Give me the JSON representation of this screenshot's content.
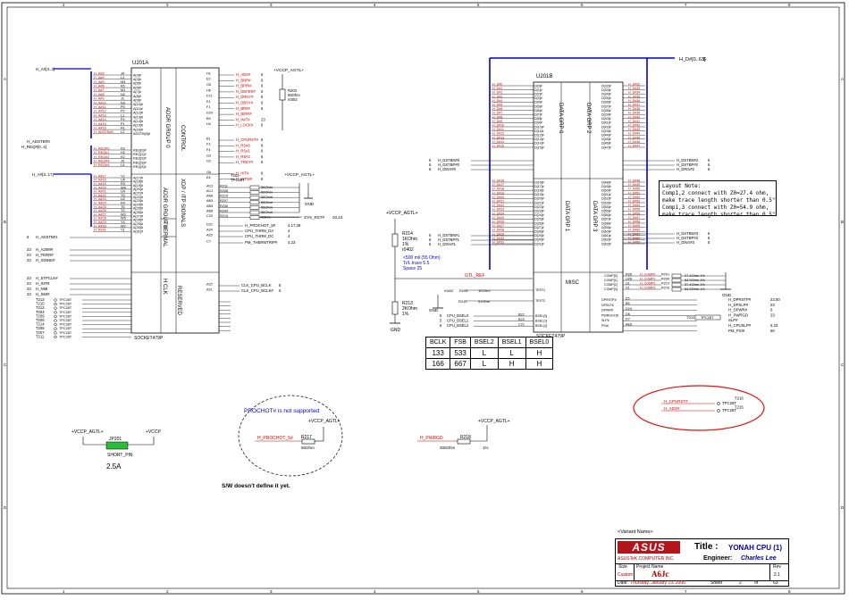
{
  "grid": {
    "cols": [
      "1",
      "2",
      "3",
      "4",
      "5",
      "6",
      "7",
      "8"
    ],
    "rows": [
      "A",
      "B",
      "C",
      "D"
    ]
  },
  "u_left": {
    "ref": "U201A",
    "part": "SOCKET479P",
    "section_labels": [
      "ADDR GROUP 0",
      "CONTROL",
      "ADDR GROUP 1",
      "XDP / ITP SIGNALS",
      "THERMAL",
      "H CLK",
      "RESERVED"
    ],
    "left_pins": [
      {
        "sig": "H_A#3",
        "pin": "J4",
        "num": "A[3]#"
      },
      {
        "sig": "H_A#4",
        "pin": "L4",
        "num": "A[4]#"
      },
      {
        "sig": "H_A#5",
        "pin": "M3",
        "num": "A[5]#"
      },
      {
        "sig": "H_A#6",
        "pin": "K5",
        "num": "A[6]#"
      },
      {
        "sig": "H_A#7",
        "pin": "M1",
        "num": "A[7]#"
      },
      {
        "sig": "H_A#8",
        "pin": "N2",
        "num": "A[8]#"
      },
      {
        "sig": "H_A#9",
        "pin": "J1",
        "num": "A[9]#"
      },
      {
        "sig": "H_A#10",
        "pin": "N3",
        "num": "A[10]#"
      },
      {
        "sig": "H_A#11",
        "pin": "P5",
        "num": "A[11]#"
      },
      {
        "sig": "H_A#12",
        "pin": "P2",
        "num": "A[12]#"
      },
      {
        "sig": "H_A#13",
        "pin": "L1",
        "num": "A[13]#"
      },
      {
        "sig": "H_A#14",
        "pin": "P4",
        "num": "A[14]#"
      },
      {
        "sig": "H_A#15",
        "pin": "P1",
        "num": "A[15]#"
      },
      {
        "sig": "H_A#16",
        "pin": "R1",
        "num": "A[16]#"
      },
      {
        "sig": "H_ADSTB#0",
        "pin": "L2",
        "num": "ADSTB[0]#"
      }
    ],
    "req_pins": [
      {
        "sig": "H_REQ#0",
        "pin": "K3"
      },
      {
        "sig": "H_REQ#1",
        "pin": "H2"
      },
      {
        "sig": "H_REQ#2",
        "pin": "K2"
      },
      {
        "sig": "H_REQ#3",
        "pin": "J3"
      },
      {
        "sig": "H_REQ#4",
        "pin": "L5"
      }
    ],
    "a17_pins": [
      {
        "sig": "H_A#17",
        "pin": "Y2"
      },
      {
        "sig": "H_A#18",
        "pin": "U5"
      },
      {
        "sig": "H_A#19",
        "pin": "R3"
      },
      {
        "sig": "H_A#20",
        "pin": "W6"
      },
      {
        "sig": "H_A#21",
        "pin": "U4"
      },
      {
        "sig": "H_A#22",
        "pin": "Y5"
      },
      {
        "sig": "H_A#23",
        "pin": "U2"
      },
      {
        "sig": "H_A#24",
        "pin": "R4"
      },
      {
        "sig": "H_A#25",
        "pin": "T5"
      },
      {
        "sig": "H_A#26",
        "pin": "T3"
      },
      {
        "sig": "H_A#27",
        "pin": "W3"
      },
      {
        "sig": "H_A#28",
        "pin": "W5"
      },
      {
        "sig": "H_A#29",
        "pin": "Y4"
      },
      {
        "sig": "H_A#30",
        "pin": "W2"
      },
      {
        "sig": "H_A#31",
        "pin": "Y1"
      }
    ],
    "ctrl_right": [
      {
        "pin": "H1",
        "sig": "H_ADS#",
        "num": "6"
      },
      {
        "pin": "E2",
        "sig": "H_BNR#",
        "num": "6"
      },
      {
        "pin": "G5",
        "sig": "H_BPRI#",
        "num": "6"
      },
      {
        "pin": "H5",
        "sig": "H_DEFER#",
        "num": "6"
      },
      {
        "pin": "F21",
        "sig": "H_DRDY#",
        "num": "6"
      },
      {
        "pin": "E1",
        "sig": "H_DBSY#",
        "num": "6"
      },
      {
        "pin": "F1",
        "sig": "H_BR0#",
        "num": "6"
      },
      {
        "pin": "D20",
        "sig": "H_IERR#",
        "num": ""
      },
      {
        "pin": "B3",
        "sig": "H_INIT#",
        "num": "23"
      },
      {
        "pin": "H4",
        "sig": "H_LOCK#",
        "num": "6"
      },
      {
        "pin": "B1",
        "sig": "H_CPURST#",
        "num": "6"
      },
      {
        "pin": "F3",
        "sig": "H_RS#0",
        "num": "6"
      },
      {
        "pin": "F4",
        "sig": "H_RS#1",
        "num": "6"
      },
      {
        "pin": "G3",
        "sig": "H_RS#2",
        "num": "6"
      },
      {
        "pin": "G2",
        "sig": "H_TRDY#",
        "num": "6"
      },
      {
        "pin": "G6",
        "sig": "H_HIT#",
        "num": "6"
      },
      {
        "pin": "E4",
        "sig": "H_HITM#",
        "num": "6"
      }
    ],
    "xdp_pins": [
      {
        "pin": "AC2",
        "ref": "R211",
        "val": "56Ohm"
      },
      {
        "pin": "AC1",
        "ref": "R208",
        "val": "56Ohm"
      },
      {
        "pin": "AA6",
        "ref": "R210",
        "val": "56Ohm"
      },
      {
        "pin": "AB3",
        "ref": "R207",
        "val": "56Ohm"
      },
      {
        "pin": "AB5",
        "ref": "R206",
        "val": "56Ohm"
      },
      {
        "pin": "AB6",
        "ref": "R209",
        "val": "56Ohm"
      },
      {
        "pin": "C20",
        "ref": "R219",
        "val": "0Ohm"
      }
    ],
    "thermal": [
      {
        "pin": "D21",
        "sig": "H_PROCHOT_5#",
        "num": "4,17,38"
      },
      {
        "pin": "A24",
        "sig": "CPU_THRM_DA",
        "num": "4"
      },
      {
        "pin": "A25",
        "sig": "CPU_THRM_DC",
        "num": "4"
      },
      {
        "pin": "C7",
        "sig": "PM_THERMTRIP#",
        "num": "4,23"
      }
    ],
    "bclk": [
      {
        "pin": "A22",
        "sig": "CLK_CPU_BCLK",
        "num": "5"
      },
      {
        "pin": "A21",
        "sig": "CLK_CPU_BCLK#",
        "num": "5"
      }
    ],
    "left_misc": [
      {
        "sig": "H_ADSTB#1",
        "num": "6"
      },
      {
        "sig": "H_A20M#",
        "num": "23"
      },
      {
        "sig": "H_FERR#",
        "num": "23"
      },
      {
        "sig": "H_IGNNE#",
        "num": "23"
      },
      {
        "sig": "H_STPCLK#",
        "num": "23"
      },
      {
        "sig": "H_INTR",
        "num": "23"
      },
      {
        "sig": "H_NMI",
        "num": "23"
      },
      {
        "sig": "H_SMI#",
        "num": "23"
      }
    ],
    "testpoints": [
      "T213",
      "T210",
      "T212",
      "T204",
      "T209",
      "T206",
      "T214",
      "T208",
      "T207",
      "T211"
    ],
    "tpc_label": "TPC28T",
    "r203": {
      "ref": "R203",
      "val": "56Ohm",
      "pkg": "r0402"
    },
    "t202": {
      "ref": "T202",
      "val": "TPC28T"
    },
    "sys_rst": "SYS_RST#",
    "sys_rst_num": "20,24",
    "gnd": "GND"
  },
  "u_right": {
    "ref": "U201B",
    "part": "SOCKET479P",
    "section_labels": [
      "DATA GRP 0",
      "DATA GRP 1",
      "DATA GRP 2",
      "DATA GRP 3",
      "MISC"
    ],
    "bus_label": "H_D#[0..63]",
    "bus_num": "6",
    "dstb": [
      {
        "sig": "H_DSTBN#0",
        "num": "6"
      },
      {
        "sig": "H_DSTBP#0",
        "num": "6"
      },
      {
        "sig": "H_DINV#0",
        "num": "6"
      },
      {
        "sig": "H_DSTBN#1",
        "num": "6"
      },
      {
        "sig": "H_DSTBP#1",
        "num": "6"
      },
      {
        "sig": "H_DINV#1",
        "num": "6"
      }
    ],
    "dstb_r": [
      {
        "sig": "H_DSTBN#2",
        "num": "6"
      },
      {
        "sig": "H_DSTBP#2",
        "num": "6"
      },
      {
        "sig": "H_DINV#2",
        "num": "6"
      },
      {
        "sig": "H_DSTBN#3",
        "num": "6"
      },
      {
        "sig": "H_DSTBP#3",
        "num": "6"
      },
      {
        "sig": "H_DINV#3",
        "num": "6"
      }
    ],
    "comp": [
      {
        "pin": "R26",
        "ref": "R201",
        "val": "27.4Ohm 1%"
      },
      {
        "pin": "U26",
        "ref": "R200",
        "val": "54.9Ohm 1%"
      },
      {
        "pin": "U1",
        "ref": "R213",
        "val": "27.4Ohm 1%"
      },
      {
        "pin": "V1",
        "ref": "R216",
        "val": "54.9Ohm 1%"
      }
    ],
    "comp_pins": [
      "COMP[0]",
      "COMP[1]",
      "COMP[2]",
      "COMP[3]"
    ],
    "misc_right": [
      {
        "pin": "E5",
        "sig": "H_DPRSTP#",
        "num": "23,50"
      },
      {
        "pin": "B5",
        "sig": "H_DPSLP#",
        "num": "23"
      },
      {
        "pin": "D24",
        "sig": "H_DPWR#",
        "num": "6"
      },
      {
        "pin": "D6",
        "sig": "H_PWRGD",
        "num": "23"
      },
      {
        "pin": "D7",
        "sig": "SLP#",
        "num": ""
      },
      {
        "pin": "AE6",
        "sig": "H_CPUSLP#",
        "num": "6,23"
      },
      {
        "pin": "",
        "sig": "PM_PSI#",
        "num": "50"
      }
    ],
    "misc_right_pins": [
      "DPRSTP#",
      "DPSLP#",
      "DPWR#",
      "PWRGOOD",
      "SLP#",
      "PSI#"
    ],
    "t204": {
      "ref": "T204",
      "label": "TPC28T"
    },
    "gtlref": {
      "sig": "GTL_REF",
      "r214": "R214",
      "r214v": "1KOhm",
      "r214p": "1%",
      "r213": "R213",
      "r213v": "2KOhm",
      "r213p": "1%",
      "pkg": "r0402"
    },
    "trace_note": [
      "<500 mil (55 Ohm)",
      "Tr/L trace 5.5",
      "Space 25"
    ],
    "test_r": [
      {
        "ref": "R204",
        "val": "1KOhm"
      },
      {
        "ref": "R212",
        "val": "51Ohm"
      }
    ],
    "test_pins": [
      "TEST1",
      "TEST2"
    ],
    "bsel": [
      {
        "sig": "CPU_BSEL0",
        "num": "5",
        "pin": "B22"
      },
      {
        "sig": "CPU_BSEL1",
        "num": "5",
        "pin": "B23"
      },
      {
        "sig": "CPU_BSEL2",
        "num": "5",
        "pin": "C21"
      }
    ],
    "vccp_agtl": "+VCCP_AGTL+"
  },
  "layout_note": {
    "title": "Layout Note:",
    "lines": [
      "Comp1,2 connect with Z0=27.4 ohm,",
      "make trace length shorter than 0.5\"",
      "Comp1,3 connect with Z0=54.9 ohm,",
      "make trace length shorter than 0.5\""
    ]
  },
  "fsb_table": {
    "headers": [
      "BCLK",
      "FSB",
      "BSEL2",
      "BSEL1",
      "BSEL0"
    ],
    "rows": [
      [
        "133",
        "533",
        "L",
        "L",
        "H"
      ],
      [
        "166",
        "667",
        "L",
        "H",
        "H"
      ]
    ]
  },
  "prochot_note": {
    "text": "PROCHOT# is not supported",
    "sig": "H_PROCHOT_5#",
    "ref": "R217",
    "val": "56Ohm",
    "vccp": "+VCCP_AGTL+"
  },
  "sw_note": "S/W doesn't define it yet.",
  "jumper": {
    "ref": "JP201",
    "label": "SHORT_PIN",
    "left": "+VCCP_AGTL+",
    "right": "+VCCP",
    "current": "2.5A"
  },
  "pwrgd": {
    "sig": "H_PWRGD",
    "ref": "R218",
    "val": "200Ohm",
    "pct": "1%",
    "vccp": "+VCCP_AGTL+"
  },
  "circled_tp": [
    {
      "sig": "H_CPURST#",
      "ref": "T216",
      "val": "TPC28T"
    },
    {
      "sig": "H_ADS#",
      "ref": "T215",
      "val": "TPC28T"
    }
  ],
  "titleblock": {
    "variant": "<Variant Name>",
    "logo": "ASUS",
    "title_label": "Title :",
    "title": "YONAH CPU (1)",
    "company": "ASUSTeK COMPUTER INC.",
    "engineer_label": "Engineer:",
    "engineer": "Charles Lee",
    "size_label": "Size",
    "size": "Custom",
    "project_label": "Project Name",
    "project": "A6Jc",
    "rev_label": "Rev",
    "rev": "2.1",
    "date_label": "Date:",
    "date": "Thursday, January 19, 2006",
    "sheet_label": "Sheet",
    "sheet": "2",
    "of_label": "of",
    "of": "63"
  },
  "colors": {
    "wire": "#0000cc",
    "net": "#cc0000",
    "line": "#000000",
    "green": "#2dbb3a",
    "circle": "#dd1111"
  }
}
